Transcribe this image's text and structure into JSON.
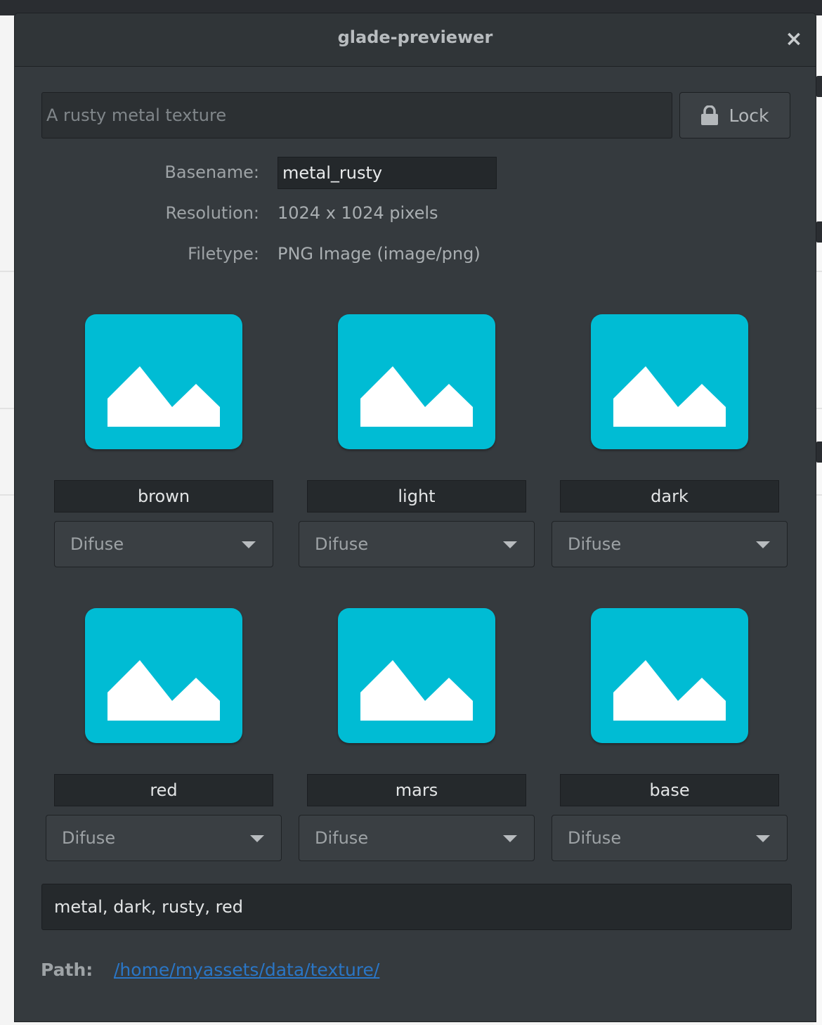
{
  "window": {
    "title": "glade-previewer",
    "close_glyph": "×"
  },
  "header": {
    "description_placeholder": "A rusty metal texture",
    "lock_label": "Lock"
  },
  "info": {
    "basename_label": "Basename:",
    "basename_value": "metal_rusty",
    "resolution_label": "Resolution:",
    "resolution_value": "1024 x 1024 pixels",
    "filetype_label": "Filetype:",
    "filetype_value": "PNG Image (image/png)"
  },
  "variants": [
    {
      "name": "brown",
      "channel": "Difuse"
    },
    {
      "name": "light",
      "channel": "Difuse"
    },
    {
      "name": "dark",
      "channel": "Difuse"
    },
    {
      "name": "red",
      "channel": "Difuse"
    },
    {
      "name": "mars",
      "channel": "Difuse"
    },
    {
      "name": "base",
      "channel": "Difuse"
    }
  ],
  "tags": {
    "value": "metal, dark, rusty, red"
  },
  "path": {
    "label": "Path:",
    "value": "/home/myassets/data/texture/"
  },
  "colors": {
    "accent_thumbnail": "#00bcd4",
    "link": "#2a76c6",
    "dialog_bg": "#353a3e"
  }
}
